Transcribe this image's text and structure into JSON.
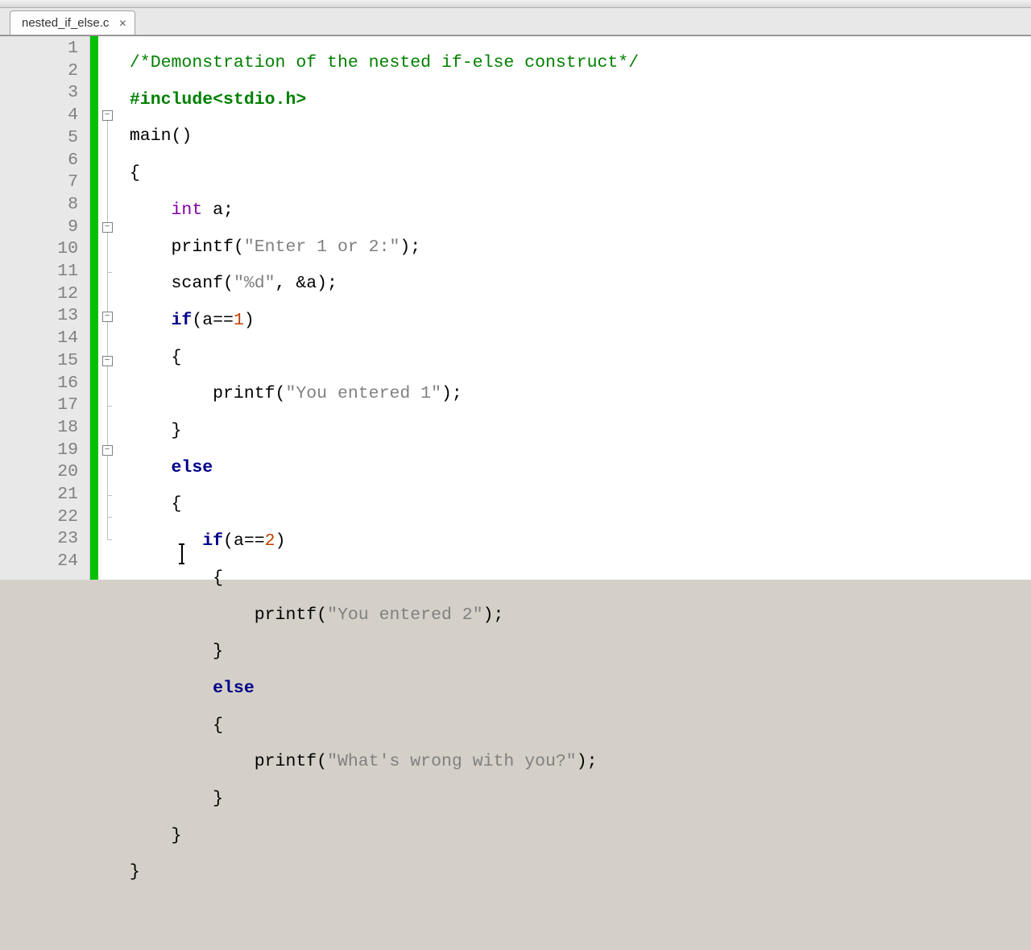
{
  "tab": {
    "title": "nested_if_else.c"
  },
  "lines": {
    "count": 24
  },
  "fold": {
    "l4": "−",
    "l9": "−",
    "l13": "−",
    "l15": "−",
    "l19": "−"
  },
  "code": {
    "l1_comment": "/*Demonstration of the nested if-else construct*/",
    "l2_include": "#include",
    "l2_hdr": "<stdio.h>",
    "l3_main": "main",
    "l3_paren": "()",
    "l4": "{",
    "l5_type": "int",
    "l5_rest": " a;",
    "l6_fn": "printf",
    "l6_p1": "(",
    "l6_str": "\"Enter 1 or 2:\"",
    "l6_p2": ");",
    "l7_fn": "scanf",
    "l7_p1": "(",
    "l7_str": "\"%d\"",
    "l7_mid": ", &a);",
    "l8_if": "if",
    "l8_p1": "(a==",
    "l8_num": "1",
    "l8_p2": ")",
    "l9": "{",
    "l10_fn": "printf",
    "l10_p1": "(",
    "l10_str": "\"You entered 1\"",
    "l10_p2": ");",
    "l11": "}",
    "l12_else": "else",
    "l13": "{",
    "l14_if": "if",
    "l14_p1": "(a==",
    "l14_num": "2",
    "l14_p2": ")",
    "l15": "{",
    "l16_fn": "printf",
    "l16_p1": "(",
    "l16_str": "\"You entered 2\"",
    "l16_p2": ");",
    "l17": "}",
    "l18_else": "else",
    "l19": "{",
    "l20_fn": "printf",
    "l20_p1": "(",
    "l20_str": "\"What's wrong with you?\"",
    "l20_p2": ");",
    "l21": "}",
    "l22": "}",
    "l23": "}",
    "l24": ""
  }
}
